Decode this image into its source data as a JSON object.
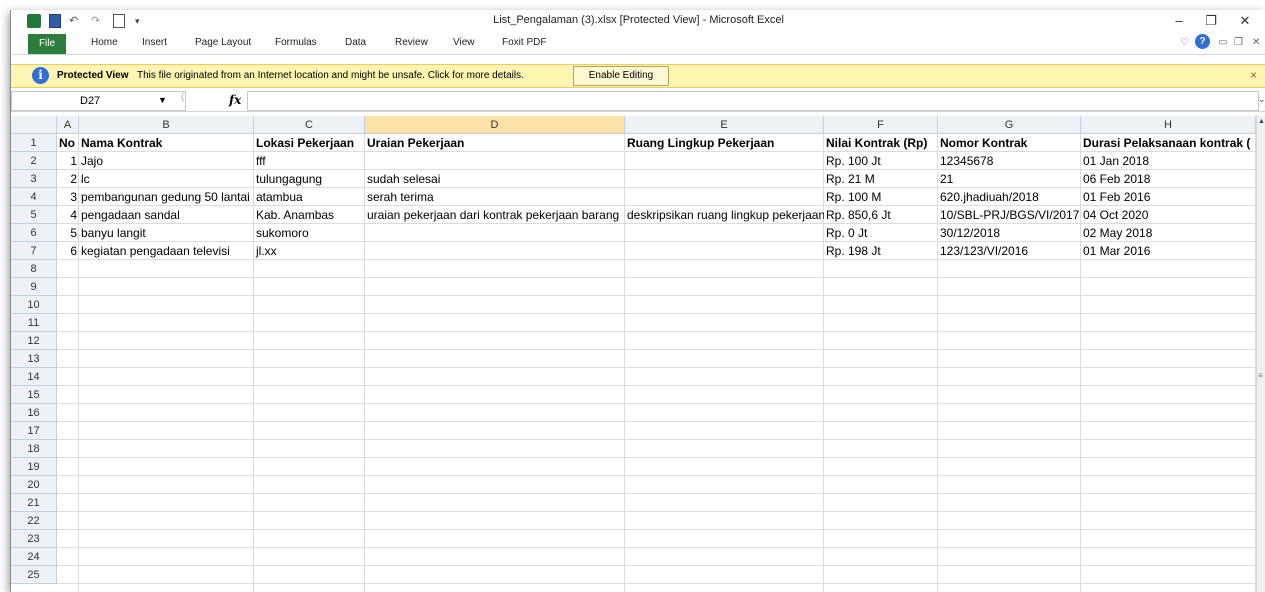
{
  "window": {
    "title": "List_Pengalaman (3).xlsx  [Protected View]  -  Microsoft Excel",
    "controls": {
      "minimize": "–",
      "restore": "❐",
      "close": "✕"
    }
  },
  "ribbon": {
    "file_label": "File",
    "tabs": [
      "Home",
      "Insert",
      "Page Layout",
      "Formulas",
      "Data",
      "Review",
      "View",
      "Foxit PDF"
    ]
  },
  "protected_view": {
    "title": "Protected View",
    "message": "This file originated from an Internet location and might be unsafe. Click for more details.",
    "button": "Enable Editing",
    "close": "×"
  },
  "formula_bar": {
    "name_box": "D27",
    "fx": "fx",
    "formula": ""
  },
  "sheet": {
    "columns": [
      "A",
      "B",
      "C",
      "D",
      "E",
      "F",
      "G",
      "H"
    ],
    "selected_column": "D",
    "header_row": [
      "No",
      "Nama Kontrak",
      "Lokasi Pekerjaan",
      "Uraian Pekerjaan",
      "Ruang Lingkup Pekerjaan",
      "Nilai Kontrak (Rp)",
      "Nomor Kontrak",
      "Durasi Pelaksanaan kontrak ("
    ],
    "rows": [
      [
        "1",
        "Jajo",
        "fff",
        "",
        "",
        "Rp. 100 Jt",
        "12345678",
        "01 Jan 2018"
      ],
      [
        "2",
        "lc",
        "tulungagung",
        "sudah selesai",
        "",
        "Rp. 21 M",
        "21",
        "06 Feb 2018"
      ],
      [
        "3",
        "pembangunan gedung 50 lantai",
        "atambua",
        "serah terima",
        "",
        "Rp. 100 M",
        "620.jhadiuah/2018",
        "01 Feb 2016"
      ],
      [
        "4",
        "pengadaan sandal",
        "Kab. Anambas",
        "uraian pekerjaan dari kontrak pekerjaan barang",
        "deskripsikan ruang lingkup pekerjaan",
        "Rp. 850,6 Jt",
        "10/SBL-PRJ/BGS/VI/2017",
        "04 Oct 2020"
      ],
      [
        "5",
        "banyu langit",
        "sukomoro",
        "",
        "",
        "Rp. 0 Jt",
        "30/12/2018",
        "02 May 2018"
      ],
      [
        "6",
        "kegiatan pengadaan televisi",
        "jl.xx",
        "",
        "",
        "Rp. 198 Jt",
        "123/123/VI/2016",
        "01 Mar 2016"
      ]
    ],
    "row_numbers": [
      "1",
      "2",
      "3",
      "4",
      "5",
      "6",
      "7",
      "8",
      "9",
      "10",
      "11",
      "12",
      "13",
      "14",
      "15",
      "16",
      "17",
      "18",
      "19",
      "20",
      "21",
      "22",
      "23",
      "24",
      "25"
    ]
  }
}
